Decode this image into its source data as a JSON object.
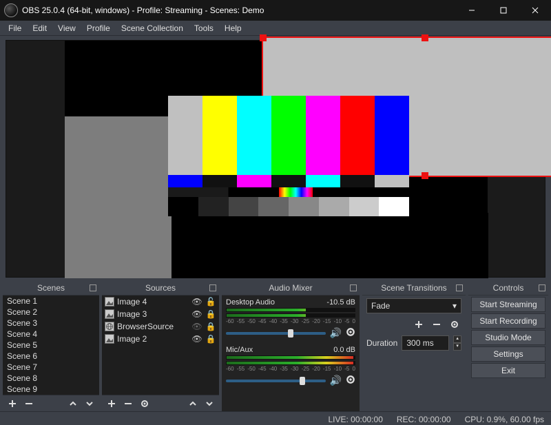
{
  "window": {
    "title": "OBS 25.0.4 (64-bit, windows) - Profile: Streaming - Scenes: Demo"
  },
  "menu": [
    "File",
    "Edit",
    "View",
    "Profile",
    "Scene Collection",
    "Tools",
    "Help"
  ],
  "panels": {
    "scenes": {
      "title": "Scenes",
      "items": [
        "Scene 1",
        "Scene 2",
        "Scene 3",
        "Scene 4",
        "Scene 5",
        "Scene 6",
        "Scene 7",
        "Scene 8",
        "Scene 9"
      ]
    },
    "sources": {
      "title": "Sources",
      "items": [
        {
          "name": "Image 4",
          "icon": "image",
          "visible": true,
          "locked": false
        },
        {
          "name": "Image 3",
          "icon": "image",
          "visible": true,
          "locked": true
        },
        {
          "name": "BrowserSource",
          "icon": "globe",
          "visible": false,
          "locked": true
        },
        {
          "name": "Image 2",
          "icon": "image",
          "visible": true,
          "locked": true
        }
      ]
    },
    "mixer": {
      "title": "Audio Mixer",
      "channels": [
        {
          "name": "Desktop Audio",
          "db": "-10.5 dB",
          "level": 0.62,
          "slider": 0.62
        },
        {
          "name": "Mic/Aux",
          "db": "0.0 dB",
          "level": 0.99,
          "slider": 0.74
        }
      ],
      "ticks": [
        "-60",
        "-55",
        "-50",
        "-45",
        "-40",
        "-35",
        "-30",
        "-25",
        "-20",
        "-15",
        "-10",
        "-5",
        "0"
      ]
    },
    "transitions": {
      "title": "Scene Transitions",
      "selected": "Fade",
      "duration_label": "Duration",
      "duration_value": "300 ms"
    },
    "controls": {
      "title": "Controls",
      "buttons": [
        "Start Streaming",
        "Start Recording",
        "Studio Mode",
        "Settings",
        "Exit"
      ]
    }
  },
  "status": {
    "live": "LIVE: 00:00:00",
    "rec": "REC: 00:00:00",
    "cpu": "CPU: 0.9%, 60.00 fps"
  }
}
